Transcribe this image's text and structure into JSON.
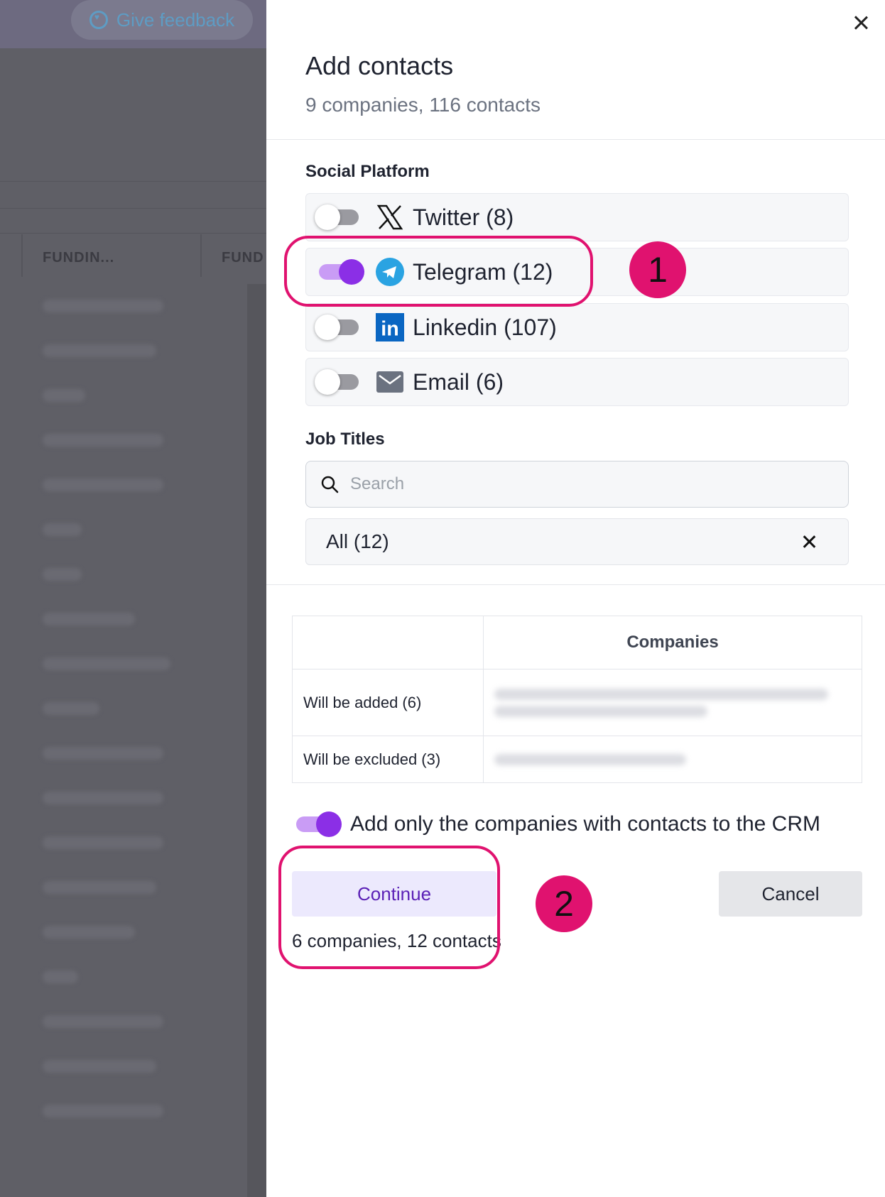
{
  "background": {
    "feedback_label": "Give feedback",
    "col1_header": "FUNDIN...",
    "col2_header": "FUND"
  },
  "panel": {
    "title": "Add contacts",
    "subtitle": "9 companies, 116 contacts",
    "social_label": "Social Platform",
    "platforms": [
      {
        "label": "Twitter (8)",
        "icon": "x-twitter-icon",
        "enabled": false
      },
      {
        "label": "Telegram (12)",
        "icon": "telegram-icon",
        "enabled": true
      },
      {
        "label": "Linkedin (107)",
        "icon": "linkedin-icon",
        "enabled": false
      },
      {
        "label": "Email (6)",
        "icon": "mail-icon",
        "enabled": false
      }
    ],
    "job_titles_label": "Job Titles",
    "search_placeholder": "Search",
    "chip_label": "All (12)",
    "table": {
      "header": "Companies",
      "rows": [
        {
          "label": "Will be added (6)"
        },
        {
          "label": "Will be excluded (3)"
        }
      ]
    },
    "crm_toggle_label": "Add only the companies with contacts to the CRM",
    "crm_toggle_enabled": true,
    "continue_label": "Continue",
    "continue_sub": "6 companies, 12 contacts",
    "cancel_label": "Cancel"
  },
  "annotations": {
    "badge1": "1",
    "badge2": "2",
    "color": "#e0126f"
  },
  "colors": {
    "accent": "#8b2fe6",
    "accent_track": "#c99cf5",
    "continue_text": "#5b21b6",
    "telegram": "#2aa3e2",
    "linkedin": "#0a66c2"
  }
}
